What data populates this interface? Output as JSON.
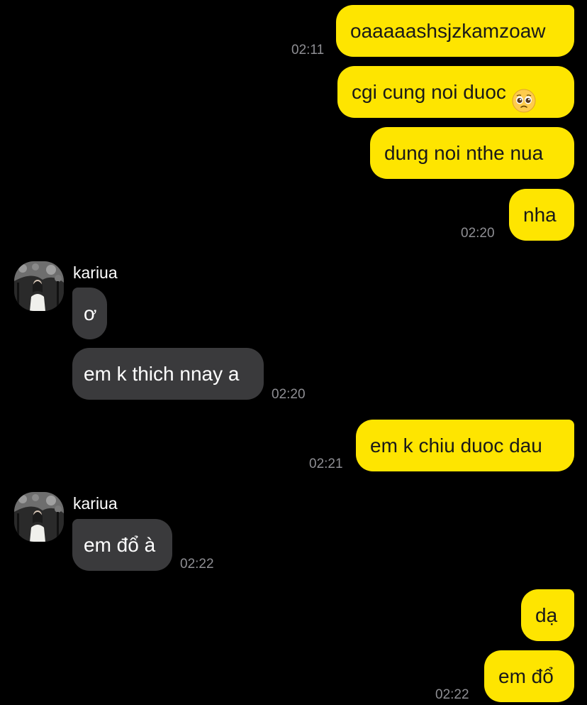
{
  "messages": [
    {
      "text": "oaaaaashsjzkamzoaw"
    },
    {
      "text": "cgi cung noi duoc",
      "emoji": "pleading-face-icon"
    },
    {
      "text": "dung noi nthe nua"
    },
    {
      "text": "nha"
    },
    {
      "text": "ơ"
    },
    {
      "text": "em k thich nnay a"
    },
    {
      "text": "em k chiu duoc dau"
    },
    {
      "text": "em đổ à"
    },
    {
      "text": "dạ"
    },
    {
      "text": "em đổ"
    }
  ],
  "times": [
    "02:11",
    "02:20",
    "02:20",
    "02:21",
    "02:22",
    "02:22"
  ],
  "sender": {
    "name": "kariua"
  },
  "colors": {
    "outgoing_bubble": "#FEE500",
    "incoming_bubble": "#3a3a3c",
    "background": "#000000",
    "timestamp": "#8e8e93"
  }
}
